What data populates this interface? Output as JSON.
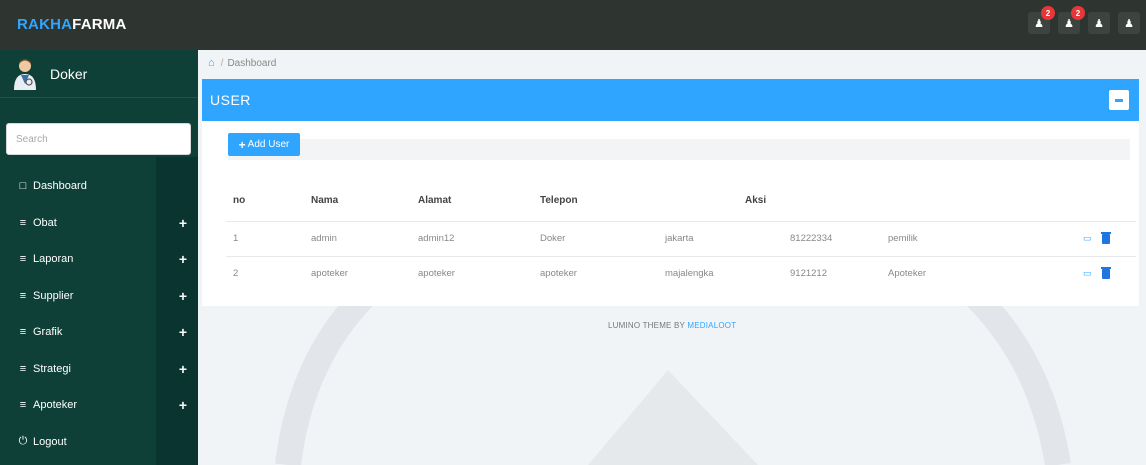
{
  "brand": {
    "part1": "RAKHA",
    "part2": "FARMA"
  },
  "top_icons": [
    {
      "icon": "user-icon",
      "badge": "2"
    },
    {
      "icon": "user-icon",
      "badge": "2"
    },
    {
      "icon": "user-icon",
      "badge": ""
    },
    {
      "icon": "user-icon",
      "badge": ""
    }
  ],
  "profile": {
    "name": "Doker"
  },
  "search": {
    "placeholder": "Search"
  },
  "nav": [
    {
      "icon": "□",
      "label": "Dashboard",
      "plus": ""
    },
    {
      "icon": "≡",
      "label": "Obat",
      "plus": "+"
    },
    {
      "icon": "≡",
      "label": "Laporan",
      "plus": "+"
    },
    {
      "icon": "≡",
      "label": "Supplier",
      "plus": "+"
    },
    {
      "icon": "≡",
      "label": "Grafik",
      "plus": "+"
    },
    {
      "icon": "≡",
      "label": "Strategi",
      "plus": "+"
    },
    {
      "icon": "≡",
      "label": "Apoteker",
      "plus": "+"
    },
    {
      "icon": "⏻",
      "label": "Logout",
      "plus": ""
    }
  ],
  "breadcrumb": {
    "home_icon": "⌂",
    "separator": "/",
    "current": "Dashboard"
  },
  "panel": {
    "title": "USER",
    "add_label": "Add User"
  },
  "table": {
    "headers": [
      "no",
      "Nama",
      "Alamat",
      "Telepon",
      "Aksi",
      "",
      "",
      ""
    ],
    "rows": [
      [
        "1",
        "admin",
        "admin12",
        "Doker",
        "jakarta",
        "81222334",
        "pemilik"
      ],
      [
        "2",
        "apoteker",
        "apoteker",
        "apoteker",
        "majalengka",
        "9121212",
        "Apoteker"
      ]
    ]
  },
  "footer": {
    "text": "LUMINO THEME BY ",
    "link": "MEDIALOOT"
  },
  "colors": {
    "accent": "#30a5ff",
    "sidebar": "#0e4038",
    "topbar": "#2e3530",
    "badge": "#e8373a"
  }
}
